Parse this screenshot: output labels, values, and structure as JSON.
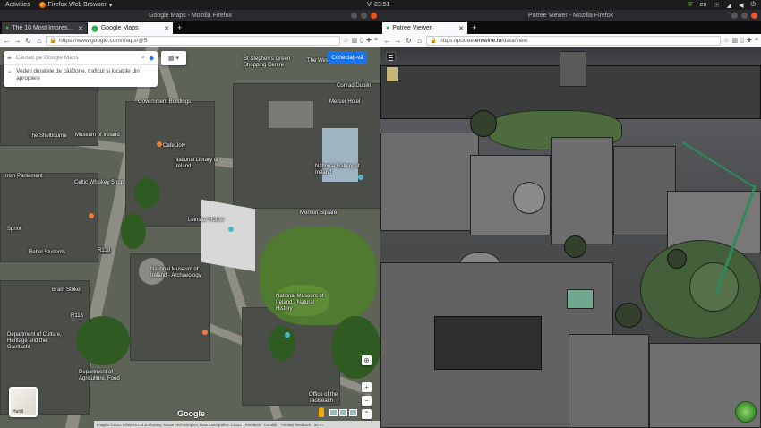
{
  "system_bar": {
    "activities": "Activities",
    "app_name": "Firefox Web Browser",
    "clock": "Vi 23:51",
    "language": "en"
  },
  "left_window": {
    "title": "Google Maps - Mozilla Firefox",
    "tabs": [
      {
        "label": "The 10 Most Impressive",
        "active": false
      },
      {
        "label": "Google Maps",
        "active": true
      }
    ],
    "url": "https://www.google.com/maps/@5",
    "search": {
      "placeholder": "Căutați pe Google Maps"
    },
    "suggestion": "Vedeți duratele de călătorie, traficul și locațiile din apropiere",
    "sign_in": "Conectați-vă",
    "minimap_label": "Hartă",
    "google_logo": "Google",
    "attribution": [
      "Imagini ©2022 Infoterra Ltd & Bluesky, Maxar Technologies, Date cartografice ©2022",
      "România",
      "Condiții",
      "Trimiteți feedback",
      "20 m"
    ],
    "map_labels": [
      "St Stephen's Green Shopping Centre",
      "The Westbury",
      "Mercer Hotel",
      "Conrad Dublin",
      "Government Buildings",
      "Cafe Joly",
      "Museum of Ireland",
      "National Gallery of Ireland",
      "National Library of Ireland",
      "National Museum of Ireland - Archaeology",
      "National Museum of Ireland - Natural History",
      "Leinster House",
      "The Shelbourne",
      "Merrion Square",
      "Department of Agriculture, Food",
      "Office of the Taoiseach",
      "Department of Culture, Heritage and the Gaeltacht",
      "Bram Stoker",
      "Rebel Students",
      "R138",
      "R118",
      "Irish Parliament",
      "Sprint",
      "Celtic Whiskey Shop"
    ]
  },
  "right_window": {
    "title": "Potree Viewer - Mozilla Firefox",
    "tabs": [
      {
        "label": "Potree Viewer",
        "active": true
      }
    ],
    "url_prefix": "https://potree.",
    "url_domain": "entwine.io",
    "url_rest": "/data/view"
  }
}
